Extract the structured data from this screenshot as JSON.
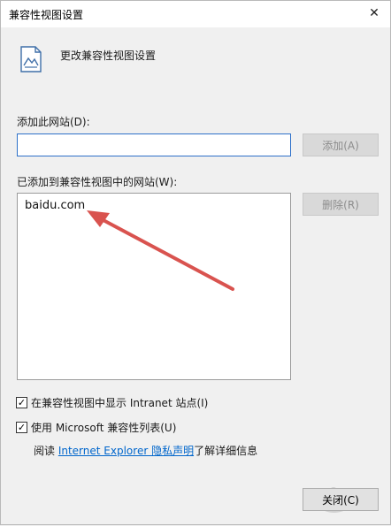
{
  "window": {
    "title": "兼容性视图设置",
    "close_glyph": "✕"
  },
  "header": {
    "icon": "compat-page-icon",
    "text": "更改兼容性视图设置"
  },
  "add_site": {
    "label": "添加此网站(D):",
    "input_value": "",
    "button_label": "添加(A)"
  },
  "site_list": {
    "label": "已添加到兼容性视图中的网站(W):",
    "items": [
      "baidu.com"
    ],
    "remove_label": "删除(R)"
  },
  "options": {
    "intranet_label": "在兼容性视图中显示 Intranet 站点(I)",
    "intranet_checked": true,
    "ms_list_label": "使用 Microsoft 兼容性列表(U)",
    "ms_list_checked": true,
    "check_glyph": "✓"
  },
  "privacy": {
    "prefix": "阅读 ",
    "link": "Internet Explorer 隐私声明",
    "suffix": "了解详细信息"
  },
  "footer": {
    "close_label": "关闭(C)"
  },
  "colors": {
    "annotation_arrow": "#d9534f",
    "link": "#0066cc",
    "input_focus_border": "#2e71c9"
  }
}
